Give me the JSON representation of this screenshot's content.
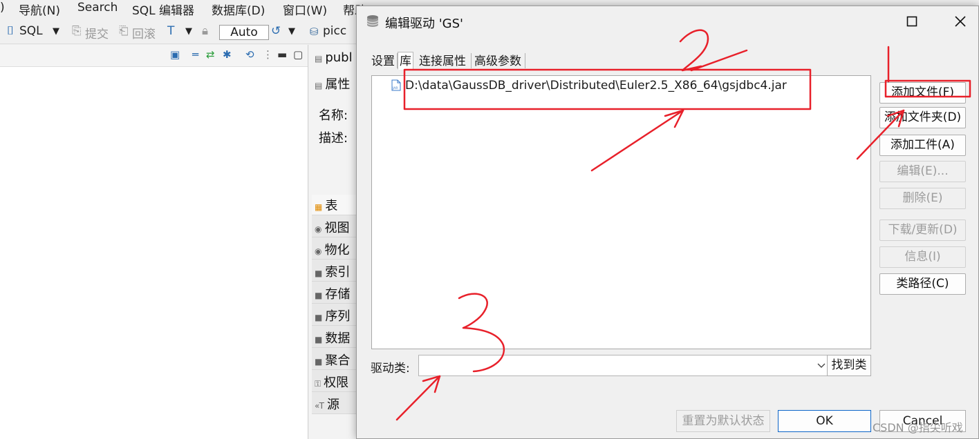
{
  "menu": {
    "items": [
      ")",
      "导航(N)",
      "Search",
      "SQL 编辑器",
      "数据库(D)",
      "窗口(W)",
      "帮助(H)"
    ]
  },
  "toolbar": {
    "sql_label": "SQL",
    "commit_label": "提交",
    "rollback_label": "回滚",
    "auto_label": "Auto",
    "connection_label": "picc"
  },
  "background_panel": {
    "tab_label": "publ",
    "properties_label": "属性",
    "name_label": "名称:",
    "desc_label": "描述:",
    "items": [
      "表",
      "视图",
      "物化",
      "索引",
      "存储",
      "序列",
      "数据",
      "聚合",
      "权限",
      "源"
    ]
  },
  "dialog": {
    "title": "编辑驱动 'GS'",
    "tabs": [
      "设置",
      "库",
      "连接属性",
      "高级参数"
    ],
    "active_tab": "库",
    "libraries": [
      "D:\\data\\GaussDB_driver\\Distributed\\Euler2.5_X86_64\\gsjdbc4.jar"
    ],
    "side_buttons": [
      {
        "label": "添加文件(F)",
        "enabled": true
      },
      {
        "label": "添加文件夹(D)",
        "enabled": true
      },
      {
        "label": "添加工件(A)",
        "enabled": true
      },
      {
        "label": "编辑(E)...",
        "enabled": false
      },
      {
        "label": "删除(E)",
        "enabled": false
      },
      {
        "label": "下载/更新(D)",
        "enabled": false
      },
      {
        "label": "信息(I)",
        "enabled": false
      },
      {
        "label": "类路径(C)",
        "enabled": true
      }
    ],
    "driver_class_label": "驱动类:",
    "driver_class_value": "",
    "find_class_label": "找到类",
    "reset_label": "重置为默认状态",
    "ok_label": "OK",
    "cancel_label": "Cancel"
  },
  "watermark": "CSDN @指尖听戏",
  "colors": {
    "annotation_red": "#e8202a",
    "ok_border": "#0a64c8",
    "jar_icon": "#3a78c8"
  }
}
